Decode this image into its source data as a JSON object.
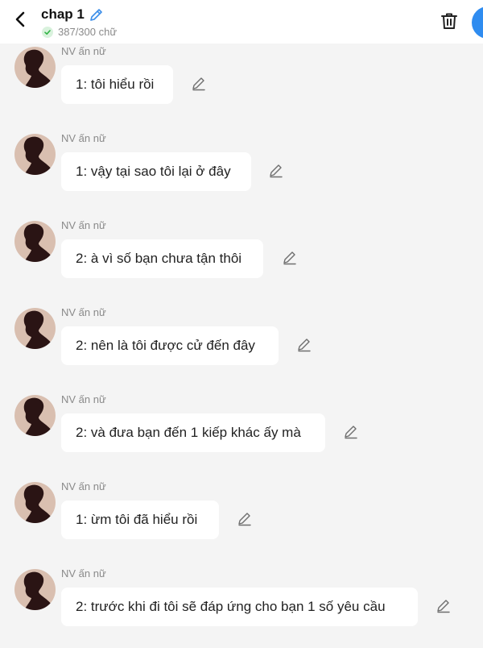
{
  "header": {
    "title": "chap 1",
    "word_count": "387/300 chữ",
    "status": "within-limit"
  },
  "messages": [
    {
      "sender": "NV ấn nữ",
      "text": "1: tôi hiểu rồi"
    },
    {
      "sender": "NV ấn nữ",
      "text": "1: vậy tại sao tôi lại ở đây"
    },
    {
      "sender": "NV ấn nữ",
      "text": "2: à vì số bạn chưa tận thôi"
    },
    {
      "sender": "NV ấn nữ",
      "text": "2: nên là tôi được cử đến đây"
    },
    {
      "sender": "NV ấn nữ",
      "text": "2: và đưa bạn đến 1 kiếp khác ấy mà"
    },
    {
      "sender": "NV ấn nữ",
      "text": "1: ừm tôi đã hiểu rồi"
    },
    {
      "sender": "NV ấn nữ",
      "text": "2: trước khi đi tôi sẽ đáp ứng cho bạn 1 số yêu cầu"
    }
  ],
  "colors": {
    "background": "#f4f4f4",
    "bubble": "#ffffff",
    "accent": "#2f8cf0",
    "check": "#2fb344",
    "avatar_bg": "#d9bfb0",
    "silhouette": "#2a1414"
  },
  "icons": {
    "back": "chevron-left-icon",
    "title_edit": "pencil-icon",
    "status": "check-circle-icon",
    "delete": "trash-icon",
    "message_edit": "pencil-icon"
  }
}
